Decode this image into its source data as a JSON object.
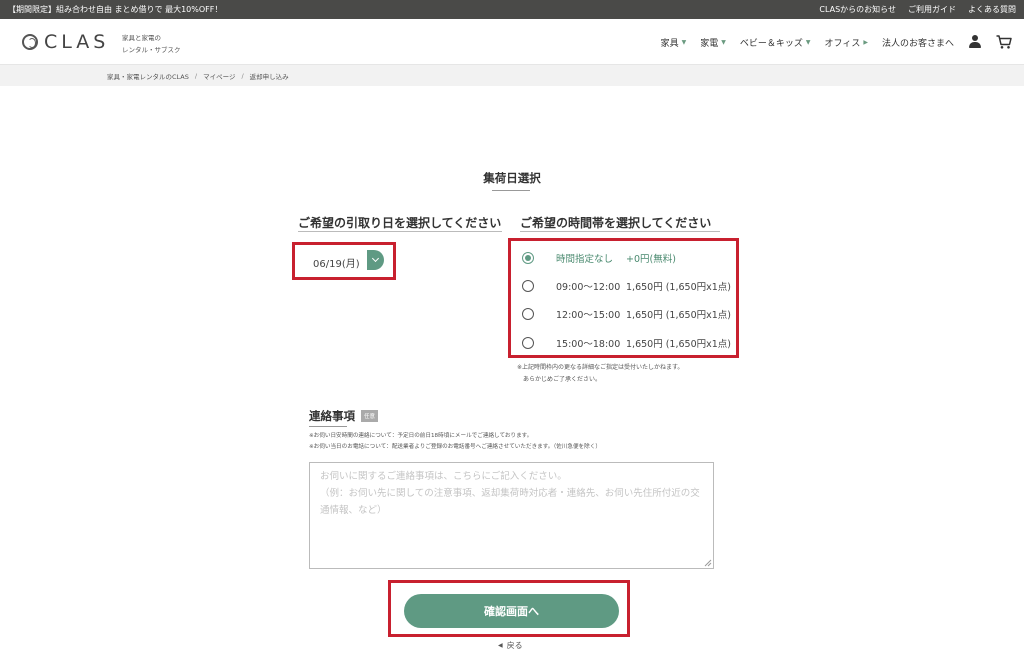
{
  "promo": {
    "text": "【期間限定】組み合わせ自由 まとめ借りで 最大10%OFF！",
    "links": [
      "CLASからのお知らせ",
      "ご利用ガイド",
      "よくある質問"
    ]
  },
  "header": {
    "logo": "CLAS",
    "tagline_1": "家具と家電の",
    "tagline_2": "レンタル・サブスク",
    "nav": [
      {
        "label": "家具"
      },
      {
        "label": "家電"
      },
      {
        "label": "ベビー＆キッズ"
      },
      {
        "label": "オフィス"
      },
      {
        "label": "法人のお客さまへ"
      }
    ]
  },
  "breadcrumb": [
    "家具・家電レンタルのCLAS",
    "マイページ",
    "返却申し込み"
  ],
  "page": {
    "title": "集荷日選択"
  },
  "date_select": {
    "heading": "ご希望の引取り日を選択してください",
    "value": "06/19(月)"
  },
  "time_select": {
    "heading": "ご希望の時間帯を選択してください",
    "options": [
      {
        "time": "時間指定なし",
        "price": "+0円(無料)",
        "checked": true
      },
      {
        "time": "09:00〜12:00",
        "price": "1,650円 (1,650円x1点)",
        "checked": false
      },
      {
        "time": "12:00〜15:00",
        "price": "1,650円 (1,650円x1点)",
        "checked": false
      },
      {
        "time": "15:00〜18:00",
        "price": "1,650円 (1,650円x1点)",
        "checked": false
      }
    ],
    "note_1": "※上記時間枠内の更なる詳細なご指定は受付いたしかねます。",
    "note_2": "あらかじめご了承ください。"
  },
  "contact": {
    "heading": "連絡事項",
    "badge": "任意",
    "note_1": "※お伺い日安時間の連絡について：予定日の前日18時頃にメールでご連絡しております。",
    "note_2": "※お伺い当日のお電話について：配送業者よりご登録のお電話番号へご連絡させていただきます。（佐川急便を除く）",
    "placeholder": "お伺いに関するご連絡事項は、こちらにご記入ください。\n（例：お伺い先に関しての注意事項、返却集荷時対応者・連絡先、お伺い先住所付近の交通情報、など）"
  },
  "actions": {
    "confirm_label": "確認画面へ",
    "back_label": "戻る"
  },
  "colors": {
    "accent": "#5f9a83",
    "highlight": "#c8202f",
    "promo_bg": "#4a4a48"
  }
}
